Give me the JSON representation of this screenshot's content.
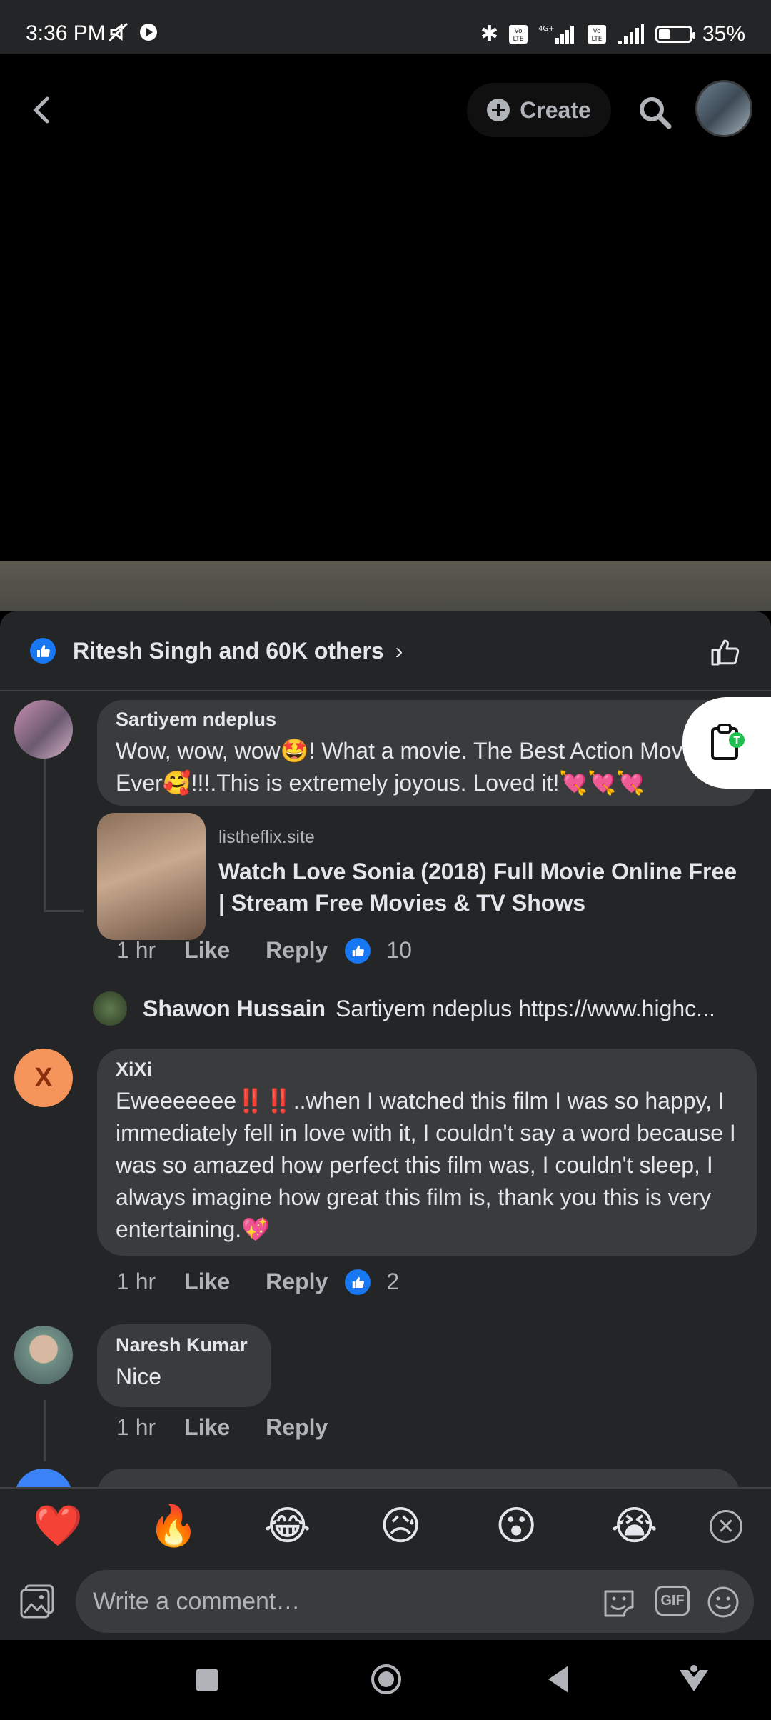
{
  "status_bar": {
    "time": "3:36 PM",
    "battery": "35%",
    "battery_level": 0.35,
    "icons": [
      "mute-icon",
      "play-icon",
      "bluetooth-icon",
      "volte-icon",
      "4g-signal-icon",
      "signal-icon",
      "battery-icon"
    ]
  },
  "header": {
    "create_label": "Create"
  },
  "reactions": {
    "summary": "Ritesh Singh and 60K others"
  },
  "comments": [
    {
      "author": "Sartiyem ndeplus",
      "text": "Wow, wow, wow🤩! What a movie. The Best Action Movie Ever🥰!!!.This is extremely joyous. Loved it!💘💘💘",
      "time": "1 hr",
      "like": "Like",
      "reply": "Reply",
      "reactions": "10",
      "link": {
        "domain": "listheflix.site",
        "title": "Watch Love Sonia (2018) Full Movie Online Free | Stream Free Movies & TV Shows"
      },
      "reply_preview": {
        "author": "Shawon Hussain",
        "text": "Sartiyem ndeplus https://www.highc..."
      }
    },
    {
      "author": "XiXi",
      "avatar_letter": "X",
      "text": "Eweeeeeee‼️‼️..when I watched this film I was so happy, I immediately fell in love with it, I couldn't say a word because I was so amazed how perfect this film was, I couldn't sleep, I always imagine how great this film is, thank you this is very entertaining.💖",
      "time": "1 hr",
      "like": "Like",
      "reply": "Reply",
      "reactions": "2"
    },
    {
      "author": "Naresh Kumar",
      "text": "Nice",
      "time": "1 hr",
      "like": "Like",
      "reply": "Reply"
    }
  ],
  "quick_emojis": [
    "❤️",
    "🔥",
    "😂",
    "😥",
    "😮",
    "😭"
  ],
  "composer": {
    "placeholder": "Write a comment…",
    "gif_label": "GIF"
  },
  "colors": {
    "background": "#242526",
    "bubble": "#3a3b3c",
    "accent": "#1877f2",
    "text": "#e4e6eb",
    "muted": "#b0b3b8",
    "xixi_avatar": "#f6955b"
  }
}
